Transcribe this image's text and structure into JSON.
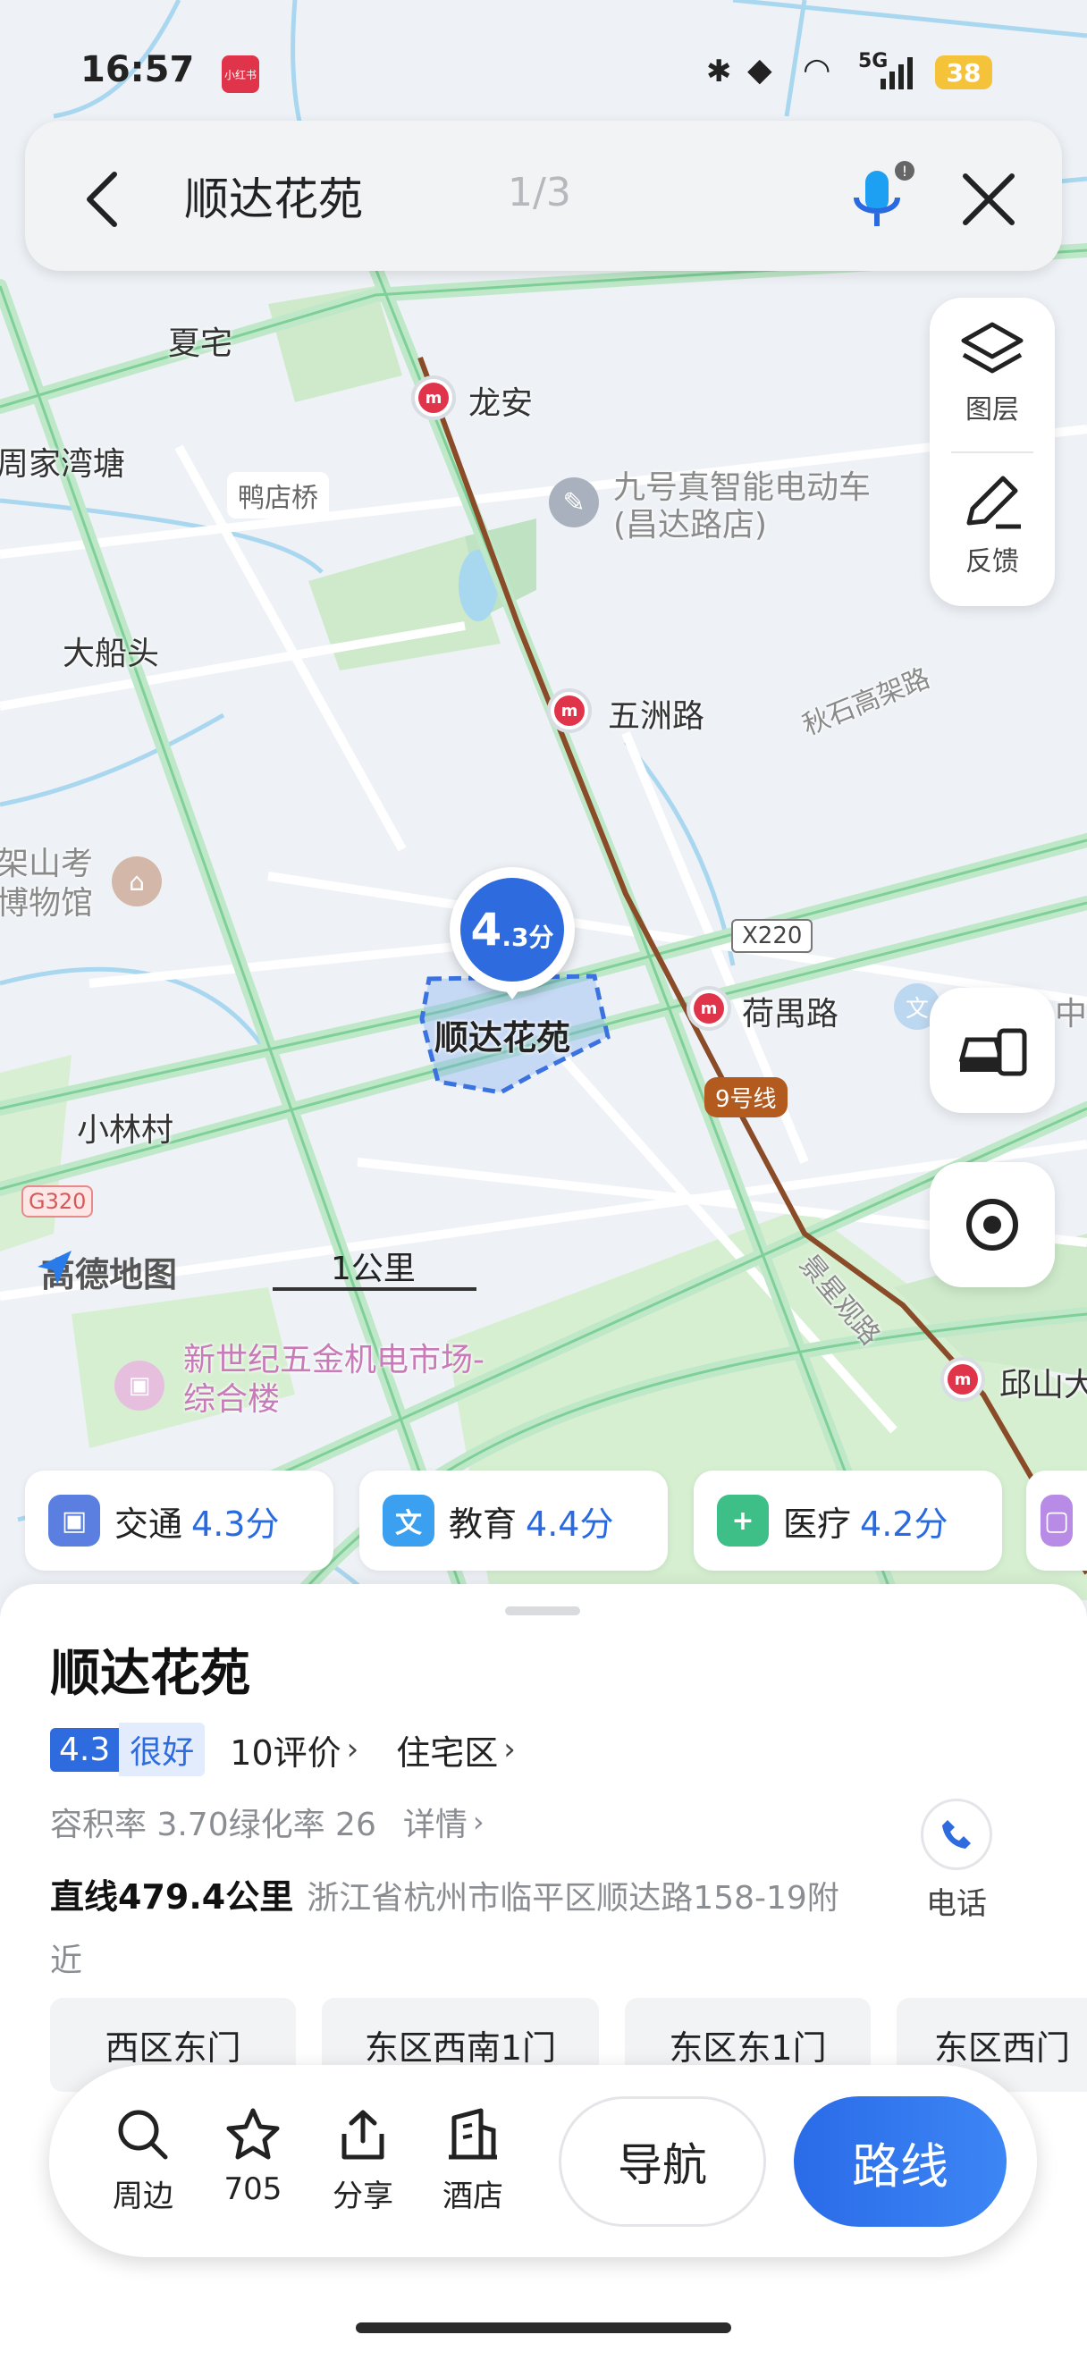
{
  "status_bar": {
    "time": "16:57",
    "app_badge": "小红书",
    "network": "5G",
    "battery": "38"
  },
  "search": {
    "query": "顺达花苑",
    "result_index": "1/3"
  },
  "map_controls": {
    "layers_label": "图层",
    "feedback_label": "反馈"
  },
  "map": {
    "labels": {
      "xiazhai": "夏宅",
      "longan": "龙安",
      "zhoujiawantang": "周家湾塘",
      "yadianqiao": "鸭店桥",
      "jiuhao_line1": "九号真智能电动车",
      "jiuhao_line2": "(昌达路店)",
      "dachuantou": "大船头",
      "wuzhoulu": "五洲路",
      "qiushi_expressway": "秋石高架路",
      "museum_line1": "架山考",
      "museum_line2": "博物馆",
      "x220": "X220",
      "heyulu": "荷禺路",
      "line9": "9号线",
      "xiaolincun": "小林村",
      "g320": "G320",
      "brand": "高德地图",
      "scale": "1公里",
      "xingguanlu": "景星观路",
      "hardware_line1": "新世纪五金机电市场-",
      "hardware_line2": "综合楼",
      "qiushan": "邱山大",
      "medical_edge": "中"
    },
    "marker": {
      "score_big": "4",
      "score_small": ".3分",
      "area_name": "顺达花苑"
    }
  },
  "chips": [
    {
      "label": "交通",
      "value": "4.3分",
      "color": "#5b7fe0",
      "icon": "train-icon"
    },
    {
      "label": "教育",
      "value": "4.4分",
      "color": "#3ba0ef",
      "icon": "education-icon"
    },
    {
      "label": "医疗",
      "value": "4.2分",
      "color": "#3dbf87",
      "icon": "medical-icon"
    }
  ],
  "place": {
    "name": "顺达花苑",
    "rating": "4.3",
    "rating_word": "很好",
    "reviews": "10评价",
    "category": "住宅区",
    "details_info": "容积率 3.70绿化率 26",
    "details_link": "详情",
    "distance": "直线479.4公里",
    "address_line1": "浙江省杭州市临平区顺达路158-19附",
    "address_line2": "近",
    "phone_label": "电话"
  },
  "doors": [
    "西区东门",
    "东区西南1门",
    "东区东1门",
    "东区西门"
  ],
  "bottom_bar": {
    "nearby": "周边",
    "favorites": "705",
    "share": "分享",
    "hotel": "酒店",
    "navigate": "导航",
    "route": "路线"
  }
}
